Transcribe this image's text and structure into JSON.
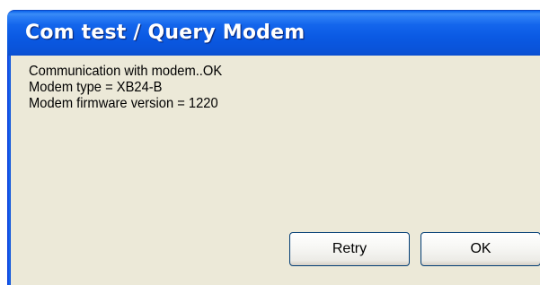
{
  "dialog": {
    "title": "Com test / Query Modem",
    "lines": [
      "Communication with modem..OK",
      "Modem type = XB24-B",
      "Modem firmware version = 1220"
    ],
    "buttons": {
      "retry_label": "Retry",
      "ok_label": "OK"
    }
  },
  "colors": {
    "titlebar": "#0a55dc",
    "title_text": "#ffffff",
    "dialog_body": "#ece9d8",
    "button_border": "#003c74"
  }
}
